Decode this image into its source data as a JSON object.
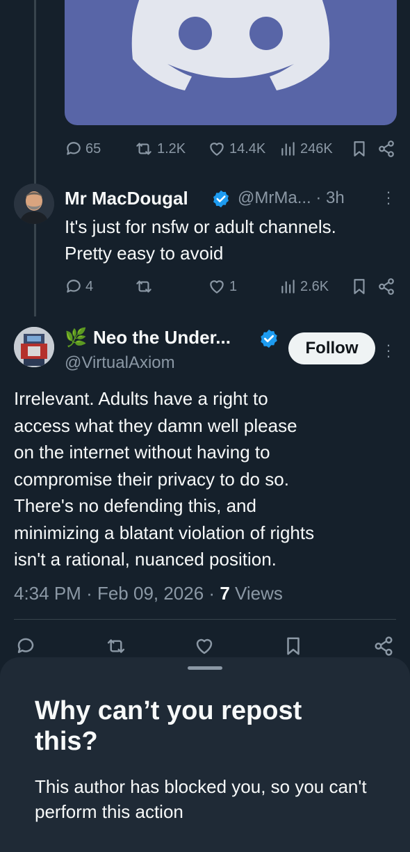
{
  "media": {
    "icon": "discord-logo-icon",
    "bg_color": "#5865a7"
  },
  "top_tweet_actions": {
    "replies": "65",
    "reposts": "1.2K",
    "likes": "14.4K",
    "views": "246K"
  },
  "reply_tweet": {
    "author_name": "Mr MacDougal",
    "handle": "@MrMa...",
    "time": "3h",
    "text_lines": [
      "It's just for nsfw or adult channels.",
      "Pretty easy to avoid"
    ],
    "actions": {
      "replies": "4",
      "reposts": "",
      "likes": "1",
      "views": "2.6K"
    }
  },
  "main_tweet": {
    "author_prefix_emoji": "🌿",
    "author_name": "Neo the Under...",
    "handle": "@VirtualAxiom",
    "follow_label": "Follow",
    "text_lines": [
      "Irrelevant. Adults have a right to",
      "access what they damn well please",
      "on the internet without having to",
      "compromise their privacy to do so.",
      "There's no defending this, and",
      "minimizing a blatant violation of rights",
      "isn't a rational, nuanced position."
    ],
    "time": "4:34 PM",
    "date": "Feb 09, 2026",
    "views_count": "7",
    "views_label": "Views"
  },
  "sheet": {
    "title": "Why can’t you repost this?",
    "body": "This author has blocked you, so you can't perform this action"
  },
  "colors": {
    "background": "#15202b",
    "verified": "#1d9bf0",
    "muted": "#8b98a5",
    "sheet": "#1f2a36"
  }
}
